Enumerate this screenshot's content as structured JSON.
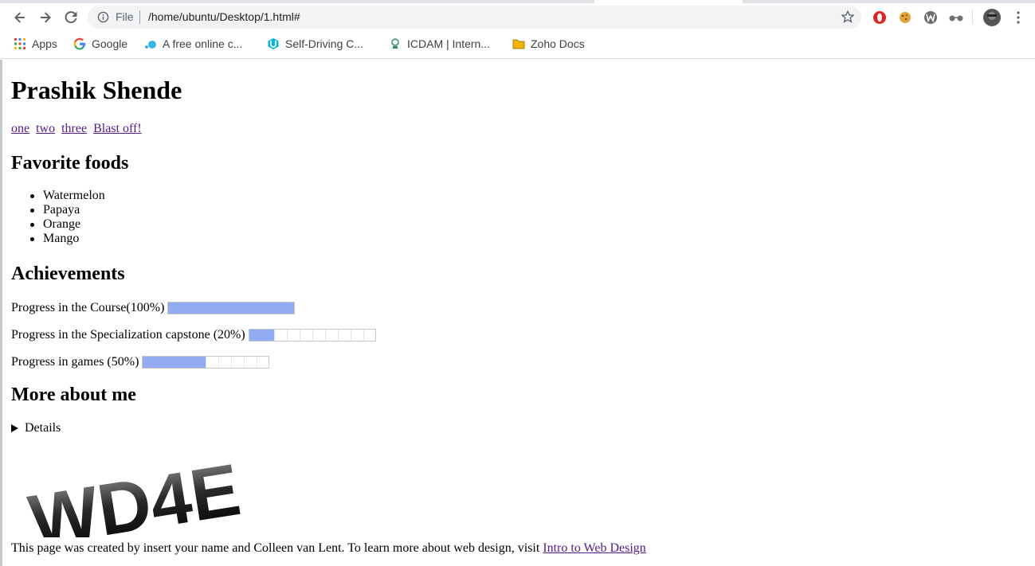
{
  "browser": {
    "url_scheme": "File",
    "url": "/home/ubuntu/Desktop/1.html#",
    "bookmarks": [
      {
        "label": "Apps",
        "icon": "apps-grid-icon"
      },
      {
        "label": "Google",
        "icon": "google-icon"
      },
      {
        "label": "A free online c...",
        "icon": "dot-icon"
      },
      {
        "label": "Self-Driving C...",
        "icon": "udacity-icon"
      },
      {
        "label": "ICDAM | Intern...",
        "icon": "icdam-icon"
      },
      {
        "label": "Zoho Docs",
        "icon": "folder-icon"
      }
    ]
  },
  "page": {
    "title": "Prashik Shende",
    "nav": [
      "one",
      "two",
      "three",
      "Blast off!"
    ],
    "foods_heading": "Favorite foods",
    "foods": [
      "Watermelon",
      "Papaya",
      "Orange",
      "Mango"
    ],
    "achievements_heading": "Achievements",
    "progress": [
      {
        "label": "Progress in the Course(100%)",
        "value": 1.0
      },
      {
        "label": "Progress in the Specialization capstone (20%)",
        "value": 0.2
      },
      {
        "label": "Progress in games (50%)",
        "value": 0.5
      }
    ],
    "more_heading": "More about me",
    "details_summary": "Details",
    "logo_text": "WD4E",
    "footer_text": "This page was created by insert your name and Colleen van Lent. To learn more about web design, visit ",
    "footer_link": "Intro to Web Design"
  },
  "colors": {
    "link_visited": "#551a8b",
    "meter_fill": "#91abf2",
    "extension_red": "#e0201b"
  }
}
